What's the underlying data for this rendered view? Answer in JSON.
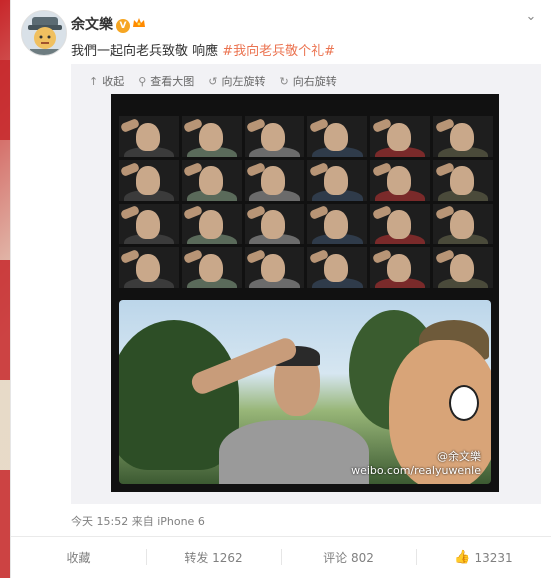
{
  "post": {
    "author": "余文樂",
    "verified_badge": "V",
    "text_plain": "我們一起向老兵致敬 响應 ",
    "hashtag": "#我向老兵敬个礼#"
  },
  "toolbar": {
    "collapse": "收起",
    "view_large": "查看大图",
    "rotate_left": "向左旋转",
    "rotate_right": "向右旋转"
  },
  "image": {
    "watermark_name": "@余文樂",
    "watermark_url": "weibo.com/realyuwenle"
  },
  "meta": {
    "time": "今天 15:52",
    "source": "来自 iPhone 6"
  },
  "actions": {
    "favorite": "收藏",
    "repost": "转发 1262",
    "comment": "评论 802",
    "like": "13231"
  },
  "icons": {
    "expand": "chevron-down-icon",
    "collapse": "arrow-up-icon",
    "view_large": "magnifier-icon",
    "rotate_left": "rotate-left-icon",
    "rotate_right": "rotate-right-icon",
    "like": "thumbs-up-icon"
  },
  "colors": {
    "accent": "#eb7350",
    "badge": "#f6a623",
    "background_red": "#c7282b"
  }
}
